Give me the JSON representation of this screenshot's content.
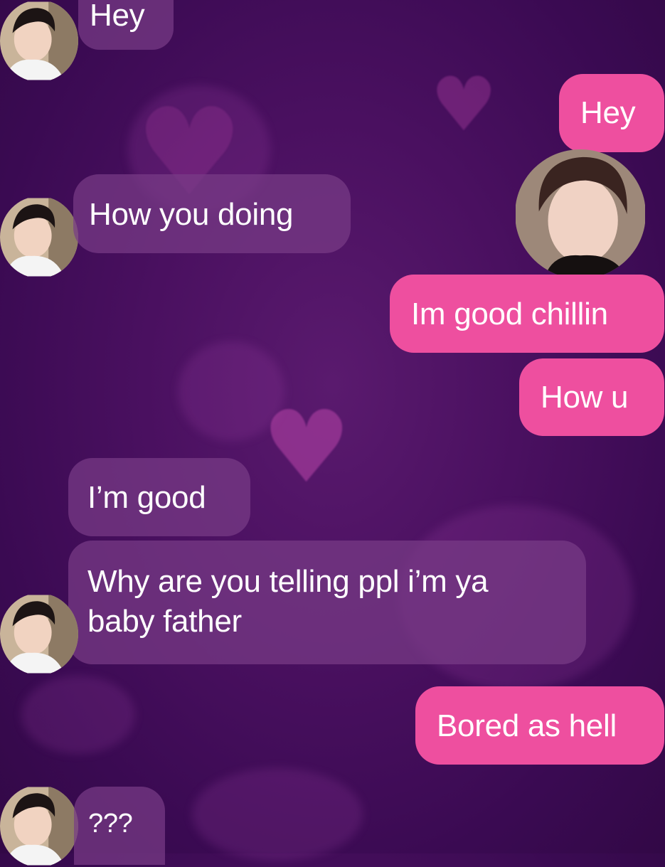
{
  "colors": {
    "background": "#4a1060",
    "received_bubble": "#7a3c87",
    "sent_bubble": "#ee4f9f",
    "text": "#ffffff"
  },
  "avatars": {
    "friend": "person-avatar",
    "me": "person-avatar"
  },
  "messages": [
    {
      "from": "friend",
      "text": "Hey"
    },
    {
      "from": "me",
      "text": "Hey"
    },
    {
      "from": "friend",
      "text": "How you doing"
    },
    {
      "from": "me",
      "text": "Im good chillin"
    },
    {
      "from": "me",
      "text": "How u"
    },
    {
      "from": "friend",
      "text": "I’m good"
    },
    {
      "from": "friend",
      "text": "Why are you telling ppl i’m ya\nbaby father"
    },
    {
      "from": "me",
      "text": "Bored as hell"
    },
    {
      "from": "friend",
      "text": "???"
    }
  ]
}
